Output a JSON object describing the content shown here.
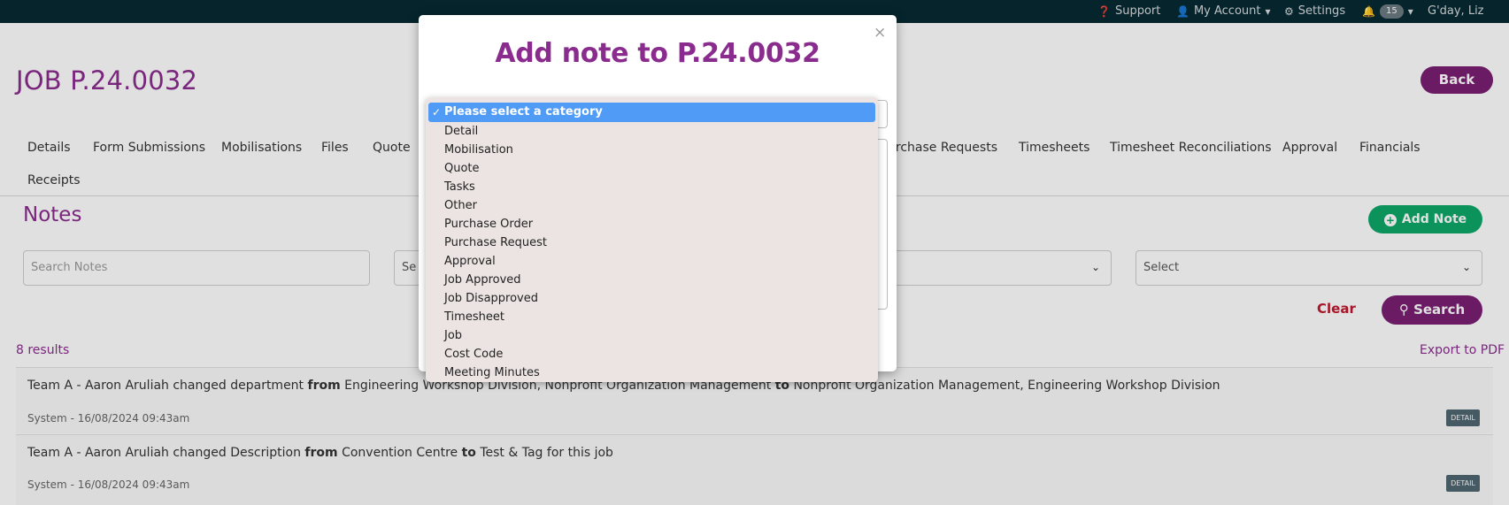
{
  "topbar": {
    "support": "Support",
    "my_account": "My Account",
    "settings": "Settings",
    "notifications": "15",
    "greeting": "G'day, Liz"
  },
  "job": {
    "title": "JOB P.24.0032",
    "back": "Back"
  },
  "tabs": [
    "Details",
    "Form Submissions",
    "Mobilisations",
    "Files",
    "Quote",
    "urchase Requests",
    "Timesheets",
    "Timesheet Reconciliations",
    "Approval",
    "Financials",
    "Receipts"
  ],
  "notes": {
    "title": "Notes",
    "add_note": "Add Note",
    "search_placeholder": "Search Notes",
    "select_1": "Se",
    "select_3": "Select",
    "clear": "Clear",
    "search": "Search",
    "results": "8 results",
    "export": "Export to PDF",
    "rows": [
      {
        "pre": "Team A - Aaron Aruliah changed department ",
        "from": "from",
        "mid": " Engineering Workshop Division, Nonprofit Organization Management ",
        "to": "to",
        "post": " Nonprofit Organization Management, Engineering Workshop Division",
        "meta": "System - 16/08/2024 09:43am",
        "tag": "DETAIL"
      },
      {
        "pre": "Team A - Aaron Aruliah changed Description ",
        "from": "from",
        "mid": " Convention Centre ",
        "to": "to",
        "post": " Test & Tag for this job",
        "meta": "System - 16/08/2024 09:43am",
        "tag": "DETAIL"
      }
    ]
  },
  "modal": {
    "title": "Add note to P.24.0032",
    "close": "×",
    "selected": "Please select a category",
    "options": [
      "Detail",
      "Mobilisation",
      "Quote",
      "Tasks",
      "Other",
      "Purchase Order",
      "Purchase Request",
      "Approval",
      "Job Approved",
      "Job Disapproved",
      "Timesheet",
      "Job",
      "Cost Code",
      "Meeting Minutes"
    ]
  },
  "colors": {
    "brand": "#8a2c8e",
    "button": "#7a1f71",
    "green": "#0ea869",
    "topbar": "#062a33",
    "highlight": "#4f9bf6"
  }
}
